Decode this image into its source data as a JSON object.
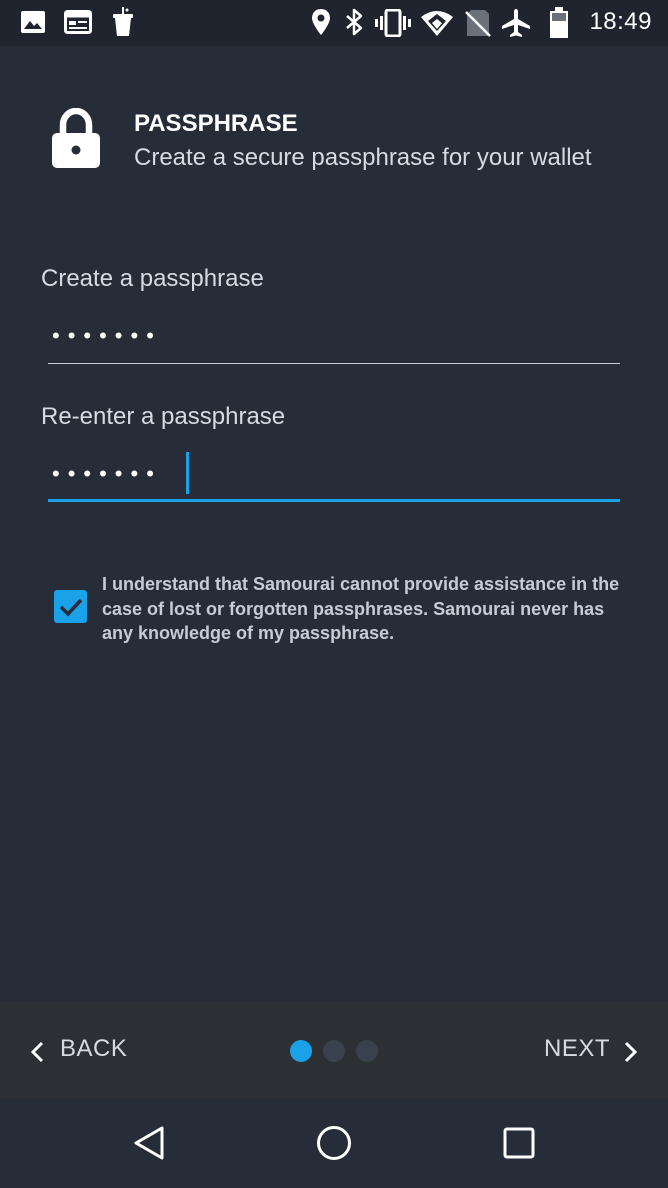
{
  "status_bar": {
    "time": "18:49",
    "left_icons": [
      "image-icon",
      "calendar-icon",
      "cup-icon"
    ],
    "right_icons": [
      "location-icon",
      "bluetooth-icon",
      "vibrate-icon",
      "wifi-icon",
      "no-sim-icon",
      "airplane-icon",
      "battery-icon"
    ]
  },
  "header": {
    "icon": "lock-icon",
    "title": "PASSPHRASE",
    "subtitle": "Create a secure passphrase for your wallet"
  },
  "form": {
    "field1": {
      "label": "Create a passphrase",
      "masked_value": "•••••••"
    },
    "field2": {
      "label": "Re-enter a passphrase",
      "masked_value": "•••••••"
    },
    "agreement": {
      "checked": true,
      "text": "I understand that Samourai cannot provide assistance in the case of lost or forgotten passphrases. Samourai never has any knowledge of my passphrase."
    }
  },
  "navigation": {
    "back_label": "BACK",
    "next_label": "NEXT",
    "steps_total": 3,
    "current_step": 1
  },
  "colors": {
    "background": "#262c38",
    "accent": "#1ba1e8",
    "nav_bar": "#2c2f34",
    "status_bar": "#1f242e"
  }
}
